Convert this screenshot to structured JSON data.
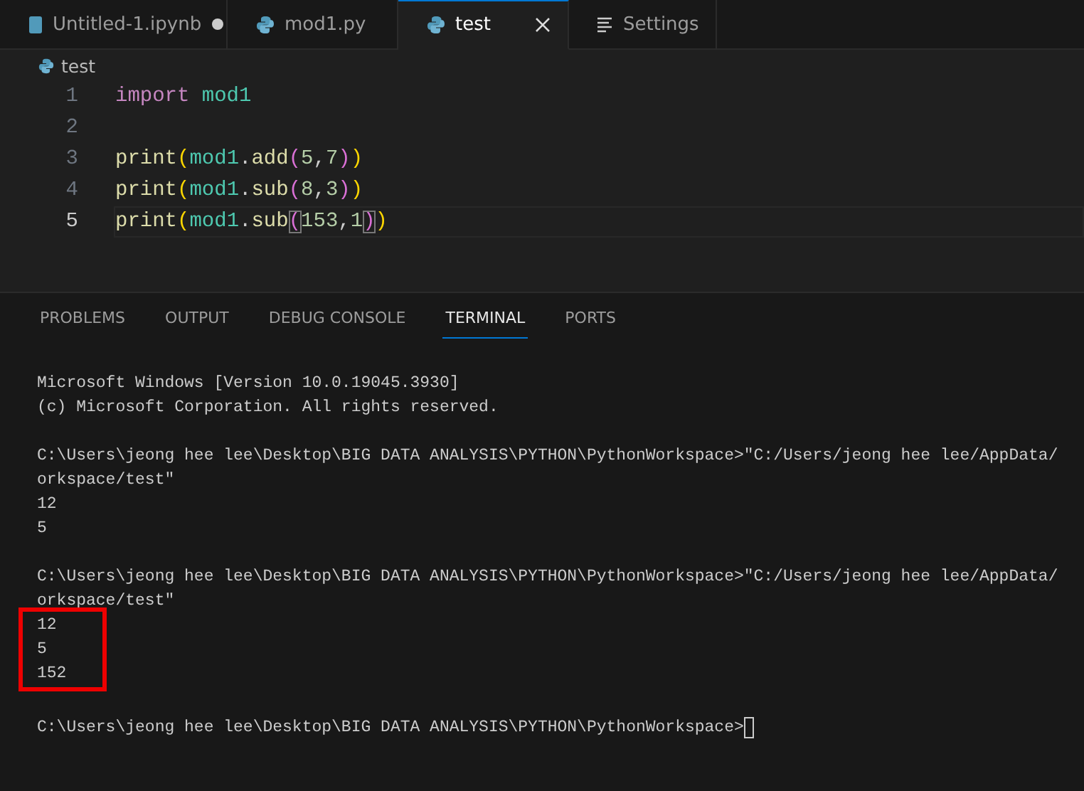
{
  "tabs": [
    {
      "label": "Untitled-1.ipynb",
      "kind": "notebook",
      "selected": false,
      "modified": true
    },
    {
      "label": "mod1.py",
      "kind": "python",
      "selected": false,
      "modified": false
    },
    {
      "label": "test",
      "kind": "python",
      "selected": true,
      "modified": false
    },
    {
      "label": "Settings",
      "kind": "settings",
      "selected": false,
      "modified": false
    }
  ],
  "breadcrumb": "test",
  "editor": {
    "lines": [
      {
        "number": "1",
        "current": false,
        "tokens": [
          {
            "text": "import",
            "kind": "keyword"
          },
          {
            "text": "mod1",
            "kind": "module"
          }
        ]
      },
      {
        "number": "2",
        "current": false
      },
      {
        "number": "3",
        "current": false,
        "tokens": [
          {
            "text": "print",
            "kind": "function"
          },
          {
            "text": "(",
            "kind": "bracket1"
          },
          {
            "text": "mod1",
            "kind": "module"
          },
          {
            "text": ".",
            "kind": "plain"
          },
          {
            "text": "add",
            "kind": "function"
          },
          {
            "text": "(",
            "kind": "bracket2"
          },
          {
            "text": "5",
            "kind": "number"
          },
          {
            "text": ",",
            "kind": "plain"
          },
          {
            "text": "7",
            "kind": "number"
          },
          {
            "text": ")",
            "kind": "bracket2"
          },
          {
            "text": ")",
            "kind": "bracket1"
          }
        ]
      },
      {
        "number": "4",
        "current": false,
        "tokens": [
          {
            "text": "print",
            "kind": "function"
          },
          {
            "text": "(",
            "kind": "bracket1"
          },
          {
            "text": "mod1",
            "kind": "module"
          },
          {
            "text": ".",
            "kind": "plain"
          },
          {
            "text": "sub",
            "kind": "function"
          },
          {
            "text": "(",
            "kind": "bracket2"
          },
          {
            "text": "8",
            "kind": "number"
          },
          {
            "text": ",",
            "kind": "plain"
          },
          {
            "text": "3",
            "kind": "number"
          },
          {
            "text": ")",
            "kind": "bracket2"
          },
          {
            "text": ")",
            "kind": "bracket1"
          }
        ]
      },
      {
        "number": "5",
        "current": true,
        "tokens": [
          {
            "text": "print",
            "kind": "function"
          },
          {
            "text": "(",
            "kind": "bracket1"
          },
          {
            "text": "mod1",
            "kind": "module"
          },
          {
            "text": ".",
            "kind": "plain"
          },
          {
            "text": "sub",
            "kind": "function"
          },
          {
            "text": "(",
            "kind": "bracket2-matched"
          },
          {
            "text": "153",
            "kind": "number"
          },
          {
            "text": ",",
            "kind": "plain"
          },
          {
            "text": "1",
            "kind": "number"
          },
          {
            "text": ")",
            "kind": "bracket2-matched"
          },
          {
            "text": ")",
            "kind": "bracket1"
          }
        ]
      }
    ]
  },
  "panel_tabs": [
    {
      "label": "PROBLEMS",
      "selected": false
    },
    {
      "label": "OUTPUT",
      "selected": false
    },
    {
      "label": "DEBUG CONSOLE",
      "selected": false
    },
    {
      "label": "TERMINAL",
      "selected": true
    },
    {
      "label": "PORTS",
      "selected": false
    }
  ],
  "terminal": [
    {
      "kind": "lines",
      "highlighted": false,
      "lines": [
        "Microsoft Windows [Version 10.0.19045.3930]",
        "(c) Microsoft Corporation. All rights reserved."
      ]
    },
    {
      "kind": "blank"
    },
    {
      "kind": "lines",
      "highlighted": false,
      "lines": [
        "C:\\Users\\jeong hee lee\\Desktop\\BIG DATA ANALYSIS\\PYTHON\\PythonWorkspace>\"C:/Users/jeong hee lee/AppData/",
        "orkspace/test\"",
        "12",
        "5"
      ]
    },
    {
      "kind": "blank"
    },
    {
      "kind": "lines",
      "highlighted": false,
      "lines": [
        "C:\\Users\\jeong hee lee\\Desktop\\BIG DATA ANALYSIS\\PYTHON\\PythonWorkspace>\"C:/Users/jeong hee lee/AppData/",
        "orkspace/test\""
      ]
    },
    {
      "kind": "lines",
      "highlighted": true,
      "lines": [
        "12",
        "5",
        "152"
      ]
    },
    {
      "kind": "blank"
    },
    {
      "kind": "prompt",
      "text": "C:\\Users\\jeong hee lee\\Desktop\\BIG DATA ANALYSIS\\PYTHON\\PythonWorkspace>",
      "cursor": true
    }
  ]
}
